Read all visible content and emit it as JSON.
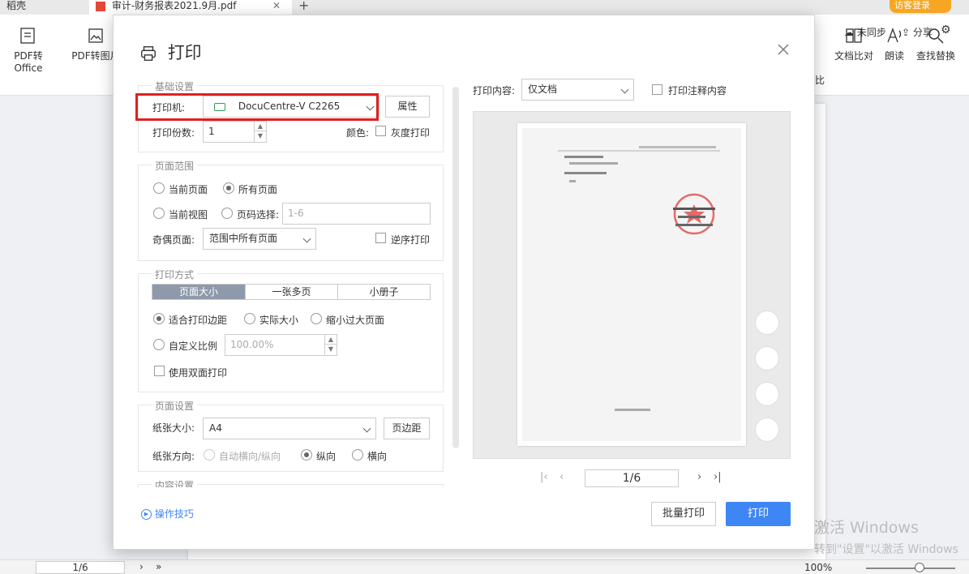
{
  "tabs": [
    {
      "label": "稻壳"
    },
    {
      "label": "审计-财务报表2021.9月.pdf"
    }
  ],
  "login_label": "访客登录",
  "toolbar": {
    "pdf_to_office": "PDF转Office",
    "pdf_to_image": "PDF转图片",
    "compare_label": "比",
    "doc_compare": "文档比对",
    "read_aloud": "朗读",
    "find_replace": "查找替换",
    "not_synced": "未同步",
    "share": "分享"
  },
  "dialog": {
    "title": "打印",
    "basic": {
      "group_title": "基础设置",
      "printer_label": "打印机:",
      "printer_value": "DocuCentre-V C2265",
      "properties_button": "属性",
      "copies_label": "打印份数:",
      "copies_value": "1",
      "color_label": "颜色:",
      "grayscale_label": "灰度打印"
    },
    "range": {
      "group_title": "页面范围",
      "current_page": "当前页面",
      "all_pages": "所有页面",
      "current_view": "当前视图",
      "page_select": "页码选择:",
      "page_select_placeholder": "1-6",
      "odd_even_label": "奇偶页面:",
      "odd_even_value": "范围中所有页面",
      "reverse_label": "逆序打印"
    },
    "mode": {
      "group_title": "打印方式",
      "tabs": [
        "页面大小",
        "一张多页",
        "小册子"
      ],
      "fit_margins": "适合打印边距",
      "actual_size": "实际大小",
      "shrink_large": "缩小过大页面",
      "custom_scale": "自定义比例",
      "custom_scale_value": "100.00%",
      "duplex_label": "使用双面打印"
    },
    "page_setup": {
      "group_title": "页面设置",
      "paper_size_label": "纸张大小:",
      "paper_size_value": "A4",
      "margins_button": "页边距",
      "orientation_label": "纸张方向:",
      "auto_orientation": "自动横向/纵向",
      "portrait": "纵向",
      "landscape": "横向"
    },
    "content_settings_title": "内容设置",
    "tips_label": "操作技巧",
    "preview": {
      "content_label": "打印内容:",
      "content_value": "仅文档",
      "annotations_label": "打印注释内容",
      "page_indicator": "1/6"
    },
    "batch_print_button": "批量打印",
    "print_button": "打印"
  },
  "status": {
    "page_indicator": "1/6",
    "zoom": "100%"
  },
  "watermark": {
    "line1": "激活 Windows",
    "line2": "转到\"设置\"以激活 Windows"
  },
  "colors": {
    "accent": "#3f86f5",
    "highlight": "#e02020",
    "segment_active": "#8e9aab",
    "login": "#f6a623"
  }
}
